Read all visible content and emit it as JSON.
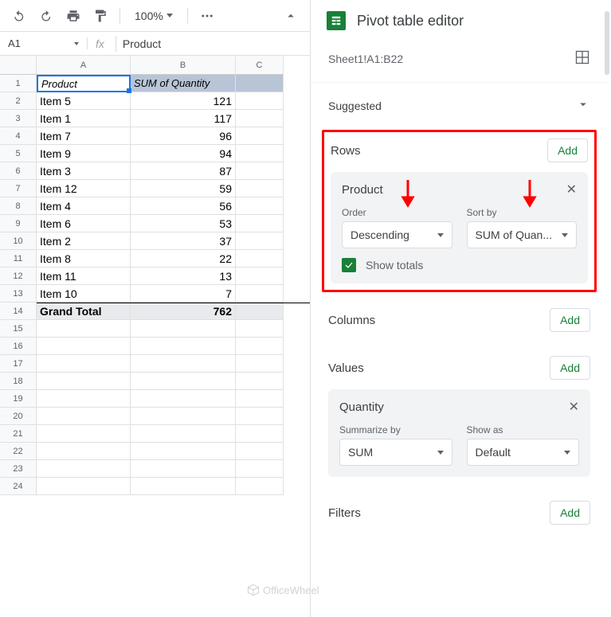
{
  "toolbar": {
    "zoom": "100%"
  },
  "formula_bar": {
    "cell_ref": "A1",
    "fx": "fx",
    "content": "Product"
  },
  "columns": [
    "A",
    "B",
    "C"
  ],
  "grid": {
    "headers": [
      "Product",
      "SUM of Quantity"
    ],
    "rows": [
      {
        "a": "Item 5",
        "b": "121"
      },
      {
        "a": "Item 1",
        "b": "117"
      },
      {
        "a": "Item 7",
        "b": "96"
      },
      {
        "a": "Item 9",
        "b": "94"
      },
      {
        "a": "Item 3",
        "b": "87"
      },
      {
        "a": "Item 12",
        "b": "59"
      },
      {
        "a": "Item 4",
        "b": "56"
      },
      {
        "a": "Item 6",
        "b": "53"
      },
      {
        "a": "Item 2",
        "b": "37"
      },
      {
        "a": "Item 8",
        "b": "22"
      },
      {
        "a": "Item 11",
        "b": "13"
      },
      {
        "a": "Item 10",
        "b": "7"
      }
    ],
    "total_label": "Grand Total",
    "total_value": "762",
    "row_count": 24
  },
  "editor": {
    "title": "Pivot table editor",
    "range": "Sheet1!A1:B22",
    "suggested": "Suggested",
    "add": "Add",
    "rows": {
      "label": "Rows",
      "card_title": "Product",
      "order_label": "Order",
      "order_value": "Descending",
      "sortby_label": "Sort by",
      "sortby_value": "SUM of Quan...",
      "show_totals": "Show totals"
    },
    "columns": {
      "label": "Columns"
    },
    "values": {
      "label": "Values",
      "card_title": "Quantity",
      "summarize_label": "Summarize by",
      "summarize_value": "SUM",
      "showas_label": "Show as",
      "showas_value": "Default"
    },
    "filters": {
      "label": "Filters"
    }
  },
  "watermark": "OfficeWheel"
}
